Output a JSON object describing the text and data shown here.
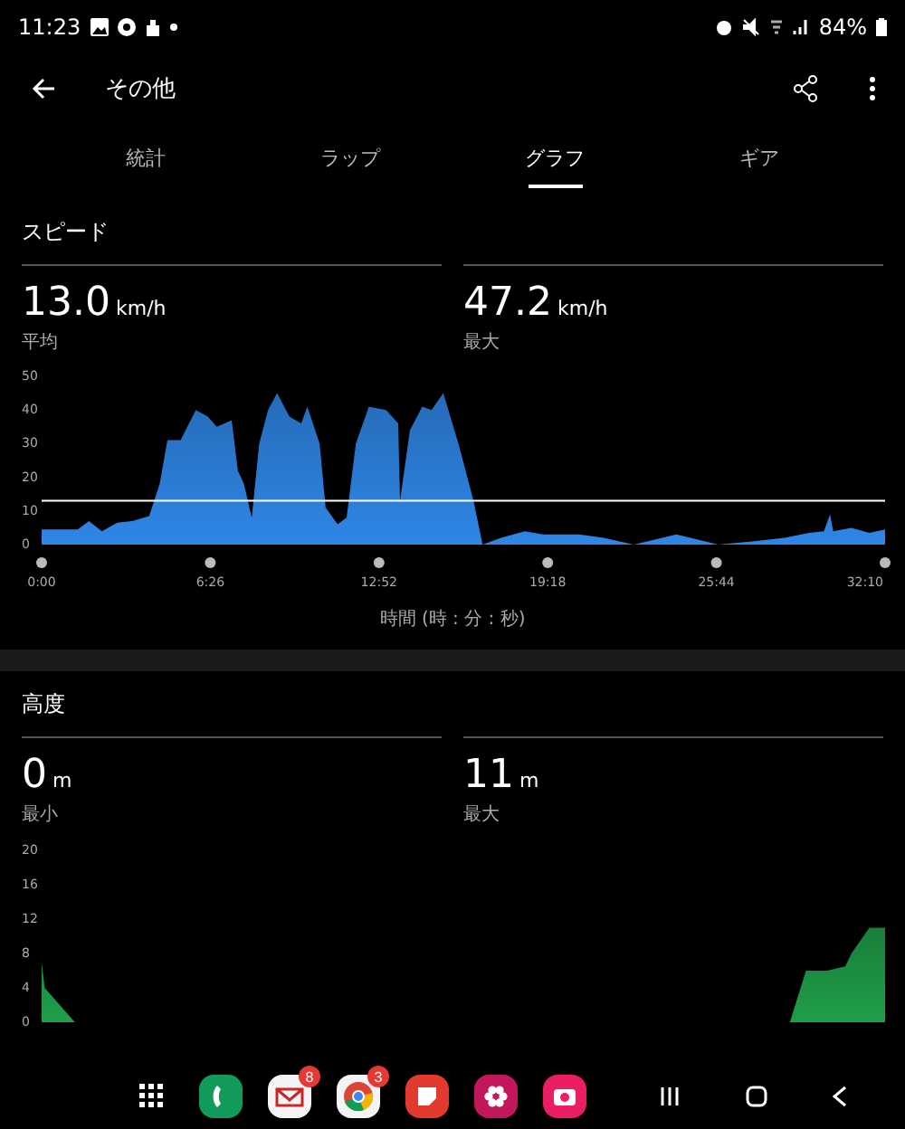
{
  "status_bar": {
    "time": "11:23",
    "battery": "84%"
  },
  "header": {
    "title": "その他"
  },
  "tabs": [
    {
      "label": "統計",
      "selected": false
    },
    {
      "label": "ラップ",
      "selected": false
    },
    {
      "label": "グラフ",
      "selected": true
    },
    {
      "label": "ギア",
      "selected": false
    }
  ],
  "sections": [
    {
      "title": "スピード",
      "stats": [
        {
          "value": "13.0",
          "unit": "km/h",
          "label": "平均"
        },
        {
          "value": "47.2",
          "unit": "km/h",
          "label": "最大"
        }
      ],
      "chart_data": {
        "type": "area",
        "xlabel": "時間 (時 : 分 : 秒)",
        "x": [
          0,
          83,
          108,
          138,
          173,
          207,
          246,
          270,
          288,
          318,
          353,
          380,
          401,
          435,
          449,
          463,
          481,
          498,
          518,
          539,
          567,
          594,
          608,
          636,
          650,
          677,
          698,
          719,
          749,
          788,
          816,
          820,
          843,
          871,
          892,
          919,
          954,
          988,
          1009,
          1051,
          1106,
          1147,
          1230,
          1286,
          1355,
          1452,
          1548,
          1631,
          1700,
          1756,
          1790,
          1804,
          1811,
          1853,
          1894,
          1930
        ],
        "series": [
          {
            "color": "#2f86e6",
            "values": [
              4.5,
              4.5,
              7,
              4,
              6.5,
              7,
              8.5,
              18,
              31,
              31,
              40,
              38,
              35,
              37,
              22,
              18,
              8,
              30,
              40,
              45,
              38,
              36,
              41,
              30,
              11,
              6,
              8,
              30,
              41,
              40,
              36,
              13,
              34,
              41,
              40,
              45,
              30,
              13,
              0,
              2,
              4,
              3,
              3,
              2,
              0,
              3,
              0,
              1,
              2,
              3.5,
              4,
              9,
              4,
              5,
              3.5,
              4.5
            ]
          },
          {
            "type": "line",
            "color": "#ffffff",
            "values": [
              13,
              13,
              13,
              13,
              13,
              13,
              13,
              13,
              13,
              13,
              13,
              13,
              13,
              13,
              13,
              13,
              13,
              13,
              13,
              13,
              13,
              13,
              13,
              13,
              13,
              13,
              13,
              13,
              13,
              13,
              13,
              13,
              13,
              13,
              13,
              13,
              13,
              13,
              13,
              13,
              13,
              13,
              13,
              13,
              13,
              13,
              13,
              13,
              13,
              13,
              13,
              13,
              13,
              13,
              13,
              13
            ]
          }
        ],
        "ylim": [
          0,
          50
        ],
        "yticks": [
          0,
          10,
          20,
          30,
          40,
          50
        ],
        "xlim": [
          0,
          1930
        ],
        "xticks": [
          {
            "value": 0,
            "label": "0:00"
          },
          {
            "value": 386,
            "label": "6:26"
          },
          {
            "value": 772,
            "label": "12:52"
          },
          {
            "value": 1158,
            "label": "19:18"
          },
          {
            "value": 1544,
            "label": "25:44"
          },
          {
            "value": 1930,
            "label": "32:10"
          }
        ]
      }
    },
    {
      "title": "高度",
      "stats": [
        {
          "value": "0",
          "unit": "m",
          "label": "最小"
        },
        {
          "value": "11",
          "unit": "m",
          "label": "最大"
        }
      ],
      "chart_data": {
        "type": "area",
        "x": [
          0,
          7,
          76,
          1712,
          1749,
          1797,
          1839,
          1853,
          1894,
          1930
        ],
        "series": [
          {
            "color": "#1f9e48",
            "values": [
              7,
              4,
              0,
              0,
              6,
              6,
              6.5,
              8,
              11,
              11
            ]
          }
        ],
        "ylim": [
          0,
          20
        ],
        "yticks": [
          0,
          4,
          8,
          12,
          16,
          20
        ],
        "xlim": [
          0,
          1930
        ]
      }
    }
  ],
  "dock": [
    {
      "kind": "apps"
    },
    {
      "kind": "phone"
    },
    {
      "kind": "mail",
      "badge": "8"
    },
    {
      "kind": "chrome",
      "badge": "3"
    },
    {
      "kind": "notes"
    },
    {
      "kind": "flower"
    },
    {
      "kind": "camera"
    }
  ]
}
